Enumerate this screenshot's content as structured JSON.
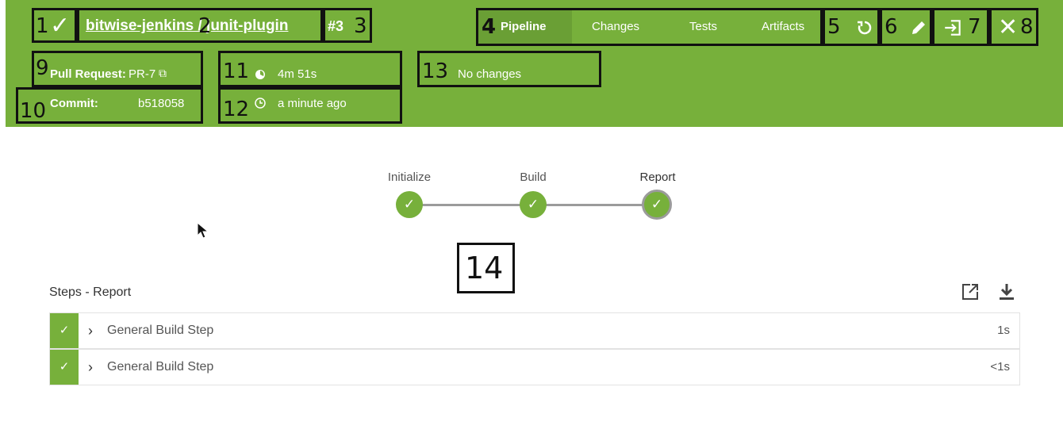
{
  "header": {
    "status_check": "✓",
    "title": "bitwise-jenkins / junit-plugin",
    "build_number": "#3",
    "tabs": [
      {
        "label": "Pipeline",
        "active": true
      },
      {
        "label": "Changes"
      },
      {
        "label": "Tests"
      },
      {
        "label": "Artifacts"
      }
    ],
    "icons": {
      "rerun": "rerun-icon",
      "edit": "edit-icon",
      "redirect": "redirect-icon",
      "close": "close-icon"
    }
  },
  "meta": {
    "pull_request_label": "Pull Request:",
    "pull_request_value": "PR-7",
    "commit_label": "Commit:",
    "commit_value": "b518058",
    "duration": "4m 51s",
    "time_ago": "a minute ago",
    "changes": "No changes"
  },
  "pipeline": {
    "stages": [
      {
        "label": "Initialize",
        "status": "success"
      },
      {
        "label": "Build",
        "status": "success"
      },
      {
        "label": "Report",
        "status": "success",
        "selected": true
      }
    ]
  },
  "steps": {
    "title": "Steps - Report",
    "rows": [
      {
        "name": "General Build Step",
        "duration": "1s"
      },
      {
        "name": "General Build Step",
        "duration": "<1s"
      }
    ]
  },
  "annotations": {
    "n1": "1",
    "n2": "2",
    "n3": "3",
    "n4": "4",
    "n5": "5",
    "n6": "6",
    "n7": "7",
    "n8": "8",
    "n9": "9",
    "n10": "10",
    "n11": "11",
    "n12": "12",
    "n13": "13",
    "n14": "14"
  },
  "colors": {
    "brand_green": "#77b03b",
    "active_tab": "#6a9f35",
    "rail": "#9b9b9b"
  }
}
